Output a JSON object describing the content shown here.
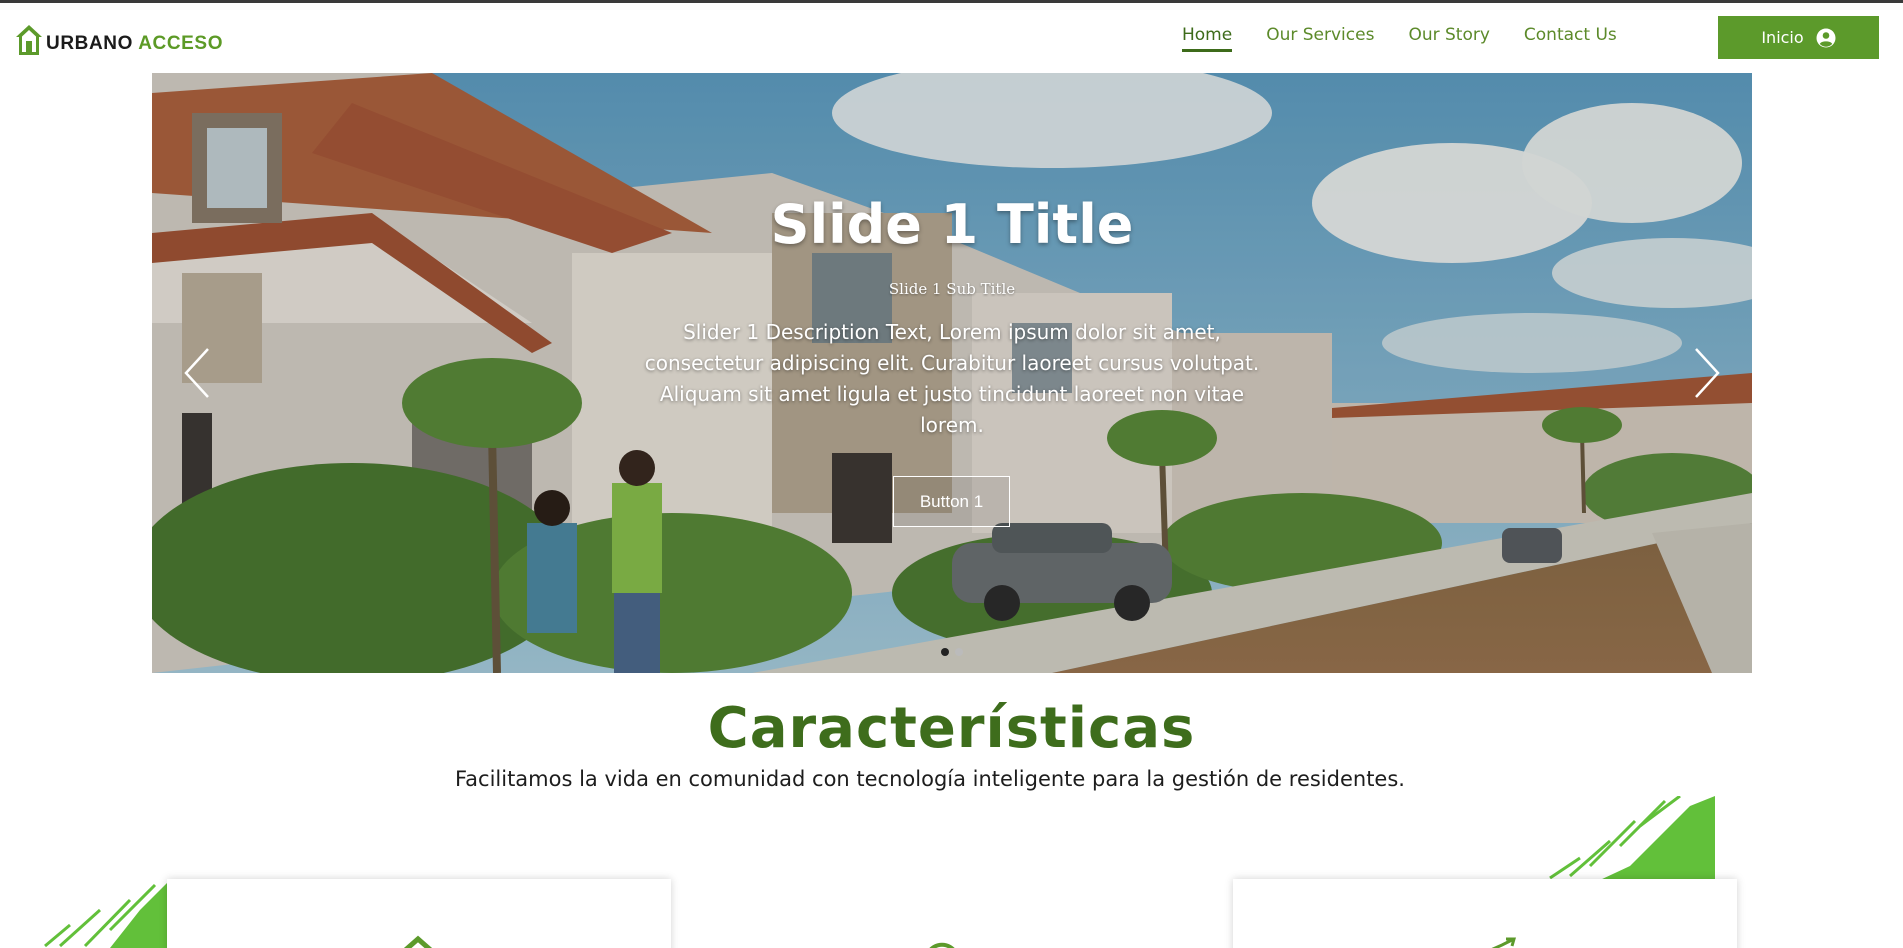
{
  "header": {
    "logo": {
      "word1": "URBANO",
      "word2": "ACCESO",
      "icon": "house-icon"
    },
    "nav": [
      {
        "label": "Home",
        "active": true
      },
      {
        "label": "Our Services",
        "active": false
      },
      {
        "label": "Our Story",
        "active": false
      },
      {
        "label": "Contact Us",
        "active": false
      }
    ],
    "cta": {
      "label": "Inicio",
      "icon": "user-circle-icon"
    }
  },
  "hero": {
    "title": "Slide 1 Title",
    "subtitle": "Slide 1 Sub Title",
    "description": "Slider 1 Description Text, Lorem ipsum dolor sit amet, consectetur adipiscing elit. Curabitur laoreet cursus volutpat. Aliquam sit amet ligula et justo tincidunt laoreet non vitae lorem.",
    "button": "Button 1",
    "slides_total": 2,
    "active_slide": 1,
    "prev_icon": "chevron-left-icon",
    "next_icon": "chevron-right-icon"
  },
  "features": {
    "title": "Características",
    "subtitle": "Facilitamos la vida en comunidad con tecnología inteligente para la gestión de residentes."
  },
  "colors": {
    "brand_green": "#5c9a2b",
    "dark_green": "#3e6d1c",
    "splash_green": "#62c03a"
  }
}
